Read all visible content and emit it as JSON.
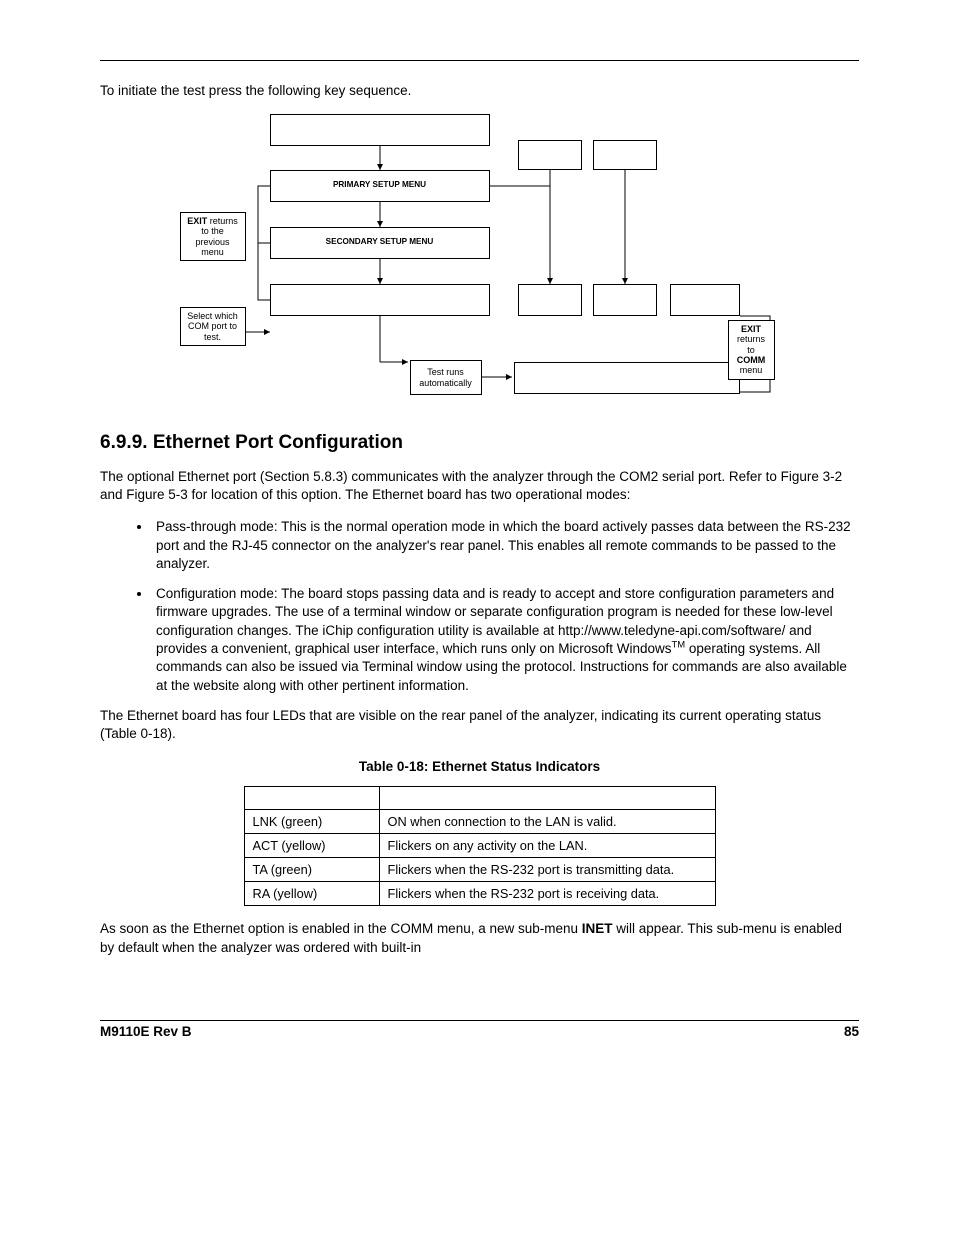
{
  "intro": "To initiate the test press the following key sequence.",
  "diagram": {
    "label_primary": "PRIMARY SETUP MENU",
    "label_secondary": "SECONDARY SETUP MENU",
    "note_exit_prev": {
      "b1": "EXIT",
      "rest": " returns to the previous menu"
    },
    "note_select": "Select which COM port to test.",
    "note_exit_comm": {
      "b1": "EXIT",
      "mid": " returns to ",
      "b2": "COMM",
      "end": " menu"
    },
    "runs": "Test runs automatically"
  },
  "section_heading": "6.9.9. Ethernet Port Configuration",
  "para1": "The optional Ethernet port (Section 5.8.3) communicates with the analyzer through the COM2 serial port. Refer to Figure 3-2 and Figure 5-3 for location of this option. The Ethernet board has two operational modes:",
  "bullets": [
    "Pass-through mode: This is the normal operation mode in which the board actively passes data between the RS-232 port and the RJ-45 connector on the analyzer's rear panel. This enables all remote commands to be passed to the analyzer.",
    "Configuration mode: The board stops passing data and is ready to accept and store configuration parameters and firmware upgrades. The use of a terminal window or separate configuration program is needed for these low-level configuration changes. The iChip configuration utility is available at http://www.teledyne-api.com/software/ and provides a convenient, graphical user interface, which runs only on Microsoft Windows<sup>TM</sup> operating systems. All commands can also be issued via Terminal window using the            protocol. Instructions for          commands are also available at the website along with other pertinent information."
  ],
  "para2_a": "The Ethernet board has four LEDs that are visible on the rear panel of the analyzer, indicating its current operating status (Table 0-18).",
  "table_caption": "Table 0-18:  Ethernet Status Indicators",
  "table": {
    "rows": [
      {
        "led": "LNK (green)",
        "fn": "ON when connection to the LAN is valid."
      },
      {
        "led": "ACT (yellow)",
        "fn": "Flickers on any activity on the LAN."
      },
      {
        "led": "TA (green)",
        "fn": "Flickers when the RS-232 port is transmitting data."
      },
      {
        "led": "RA (yellow)",
        "fn": "Flickers when the RS-232 port is receiving data."
      }
    ]
  },
  "para3_pre": "As soon as the Ethernet option is enabled in the COMM menu, a new sub-menu ",
  "para3_bold": "INET",
  "para3_post": " will appear. This sub-menu is enabled by default when the analyzer was ordered with built-in",
  "footer_left": "M9110E Rev B",
  "footer_right": "85"
}
